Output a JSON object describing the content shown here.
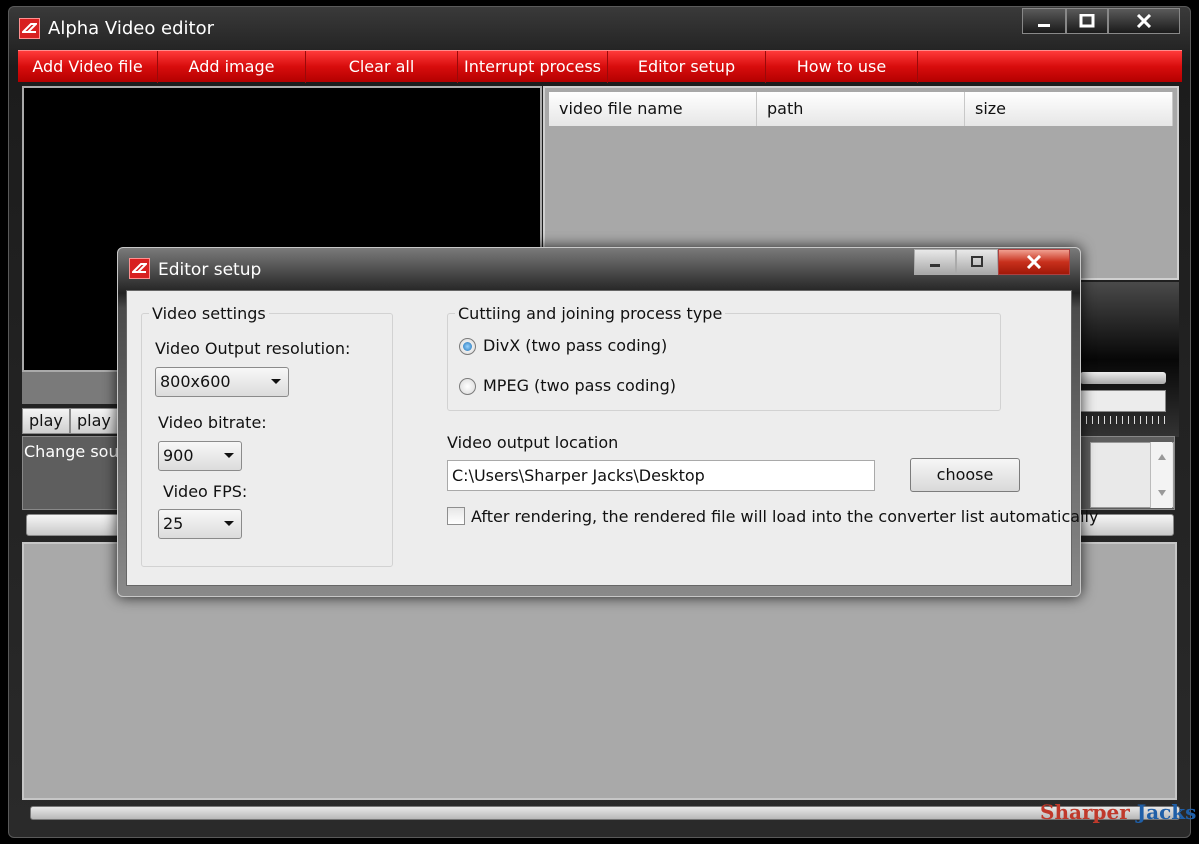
{
  "app": {
    "title": "Alpha Video editor"
  },
  "menu": {
    "items": [
      "Add Video file",
      "Add image",
      "Clear all",
      "Interrupt process",
      "Editor setup",
      "How to use"
    ]
  },
  "file_list": {
    "columns": [
      "video file name",
      "path",
      "size"
    ]
  },
  "preview_controls": {
    "play1": "play",
    "play2": "play"
  },
  "sound_panel": {
    "label": "Change soun"
  },
  "dialog": {
    "title": "Editor setup",
    "video_settings": {
      "title": "Video settings",
      "resolution_label": "Video Output resolution:",
      "resolution_value": "800x600",
      "bitrate_label": "Video bitrate:",
      "bitrate_value": "900",
      "fps_label": "Video FPS:",
      "fps_value": "25"
    },
    "process_type": {
      "title": "Cuttiing and joining process type",
      "option_divx": "DivX (two pass coding)",
      "option_mpeg": "MPEG (two pass coding)",
      "selected": "divx"
    },
    "output": {
      "label": "Video output location",
      "path": "C:\\Users\\Sharper Jacks\\Desktop",
      "choose_label": "choose"
    },
    "auto_load": {
      "label": "After rendering, the rendered file will load into the converter list automatically",
      "checked": false
    }
  },
  "watermark": {
    "part1": "Sharper",
    "part2": "Jacks"
  },
  "colors": {
    "accent_red": "#d80d0d",
    "watermark_red": "#c0392b",
    "watermark_blue": "#1f5fa8"
  }
}
